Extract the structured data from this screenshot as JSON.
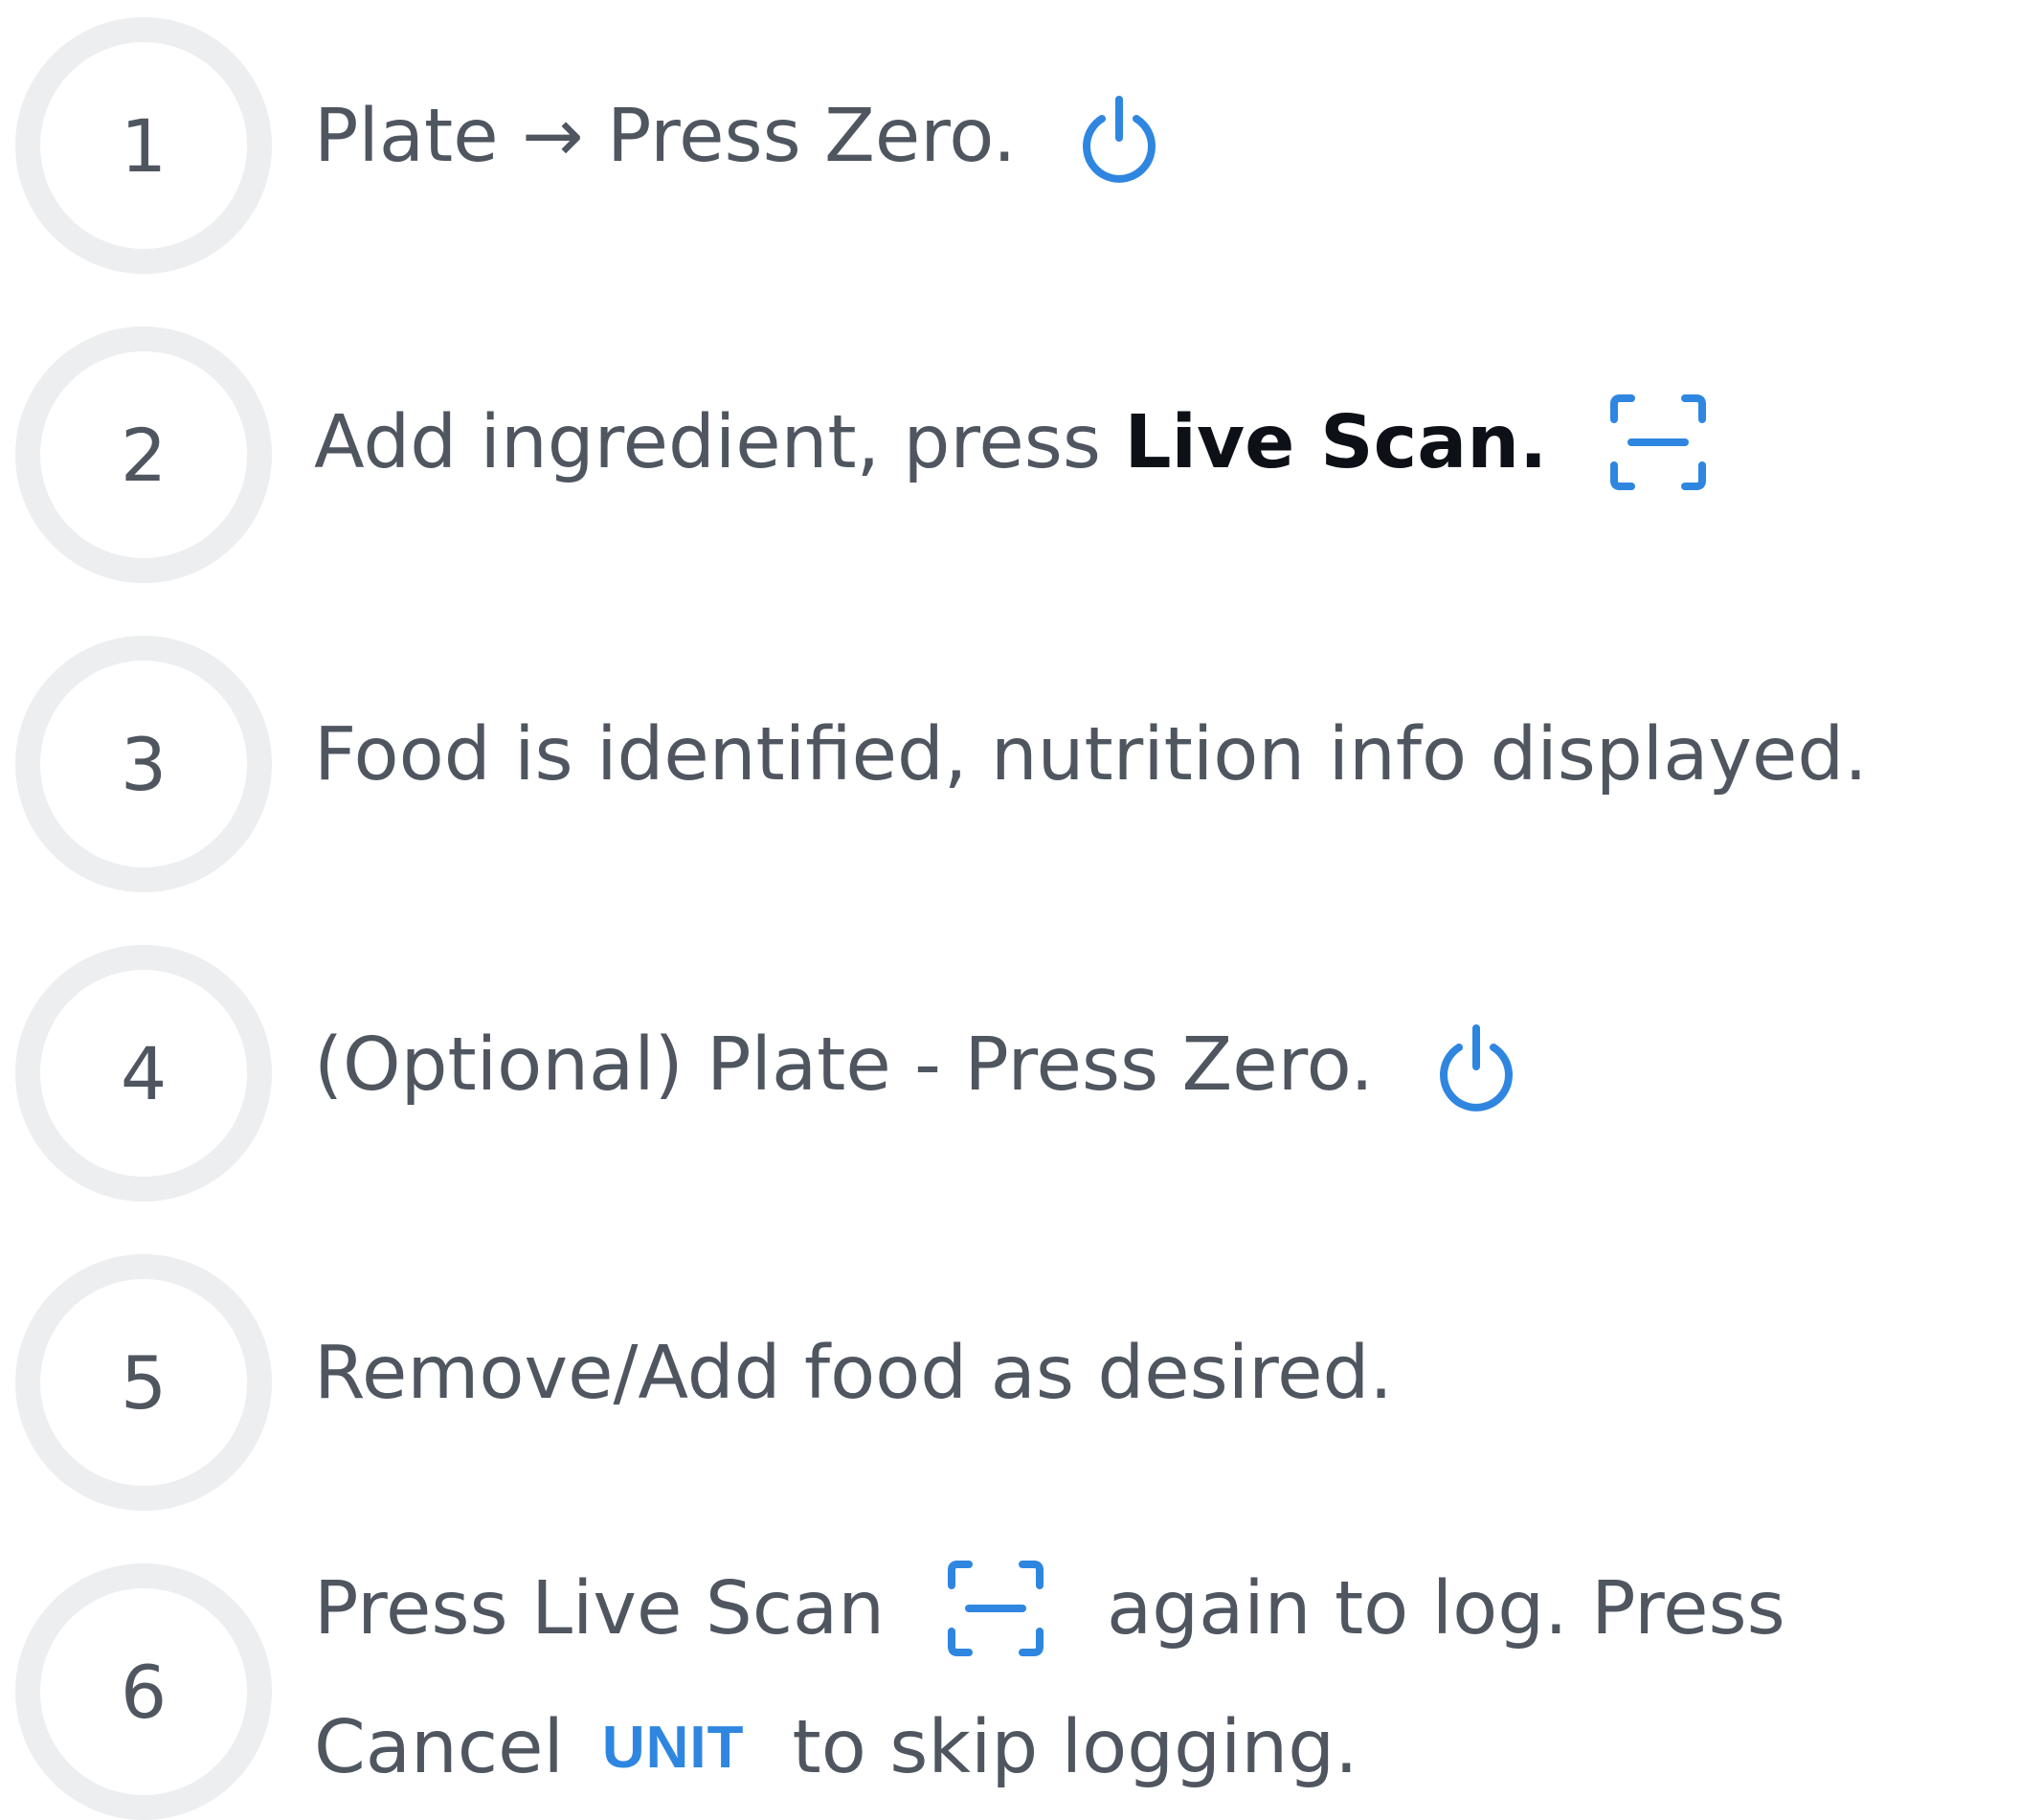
{
  "colors": {
    "accent": "#2f86e0",
    "text": "#4f5660",
    "emphasis": "#0d1117",
    "circle_ring": "#eceef0"
  },
  "steps": [
    {
      "number": "1",
      "text": "Plate → Press Zero.",
      "icon": "power-icon"
    },
    {
      "number": "2",
      "text_before": "Add ingredient, press ",
      "text_bold": "Live Scan.",
      "icon": "scan-icon"
    },
    {
      "number": "3",
      "text": "Food is identified, nutrition info displayed."
    },
    {
      "number": "4",
      "text": "(Optional) Plate - Press Zero.",
      "icon": "power-icon"
    },
    {
      "number": "5",
      "text": "Remove/Add food as desired."
    },
    {
      "number": "6",
      "line1_before": "Press Live Scan",
      "line1_icon": "scan-icon",
      "line1_after": "again to log. Press",
      "line2_before": "Cancel",
      "line2_badge": "UNIT",
      "line2_after": "to skip logging."
    }
  ]
}
